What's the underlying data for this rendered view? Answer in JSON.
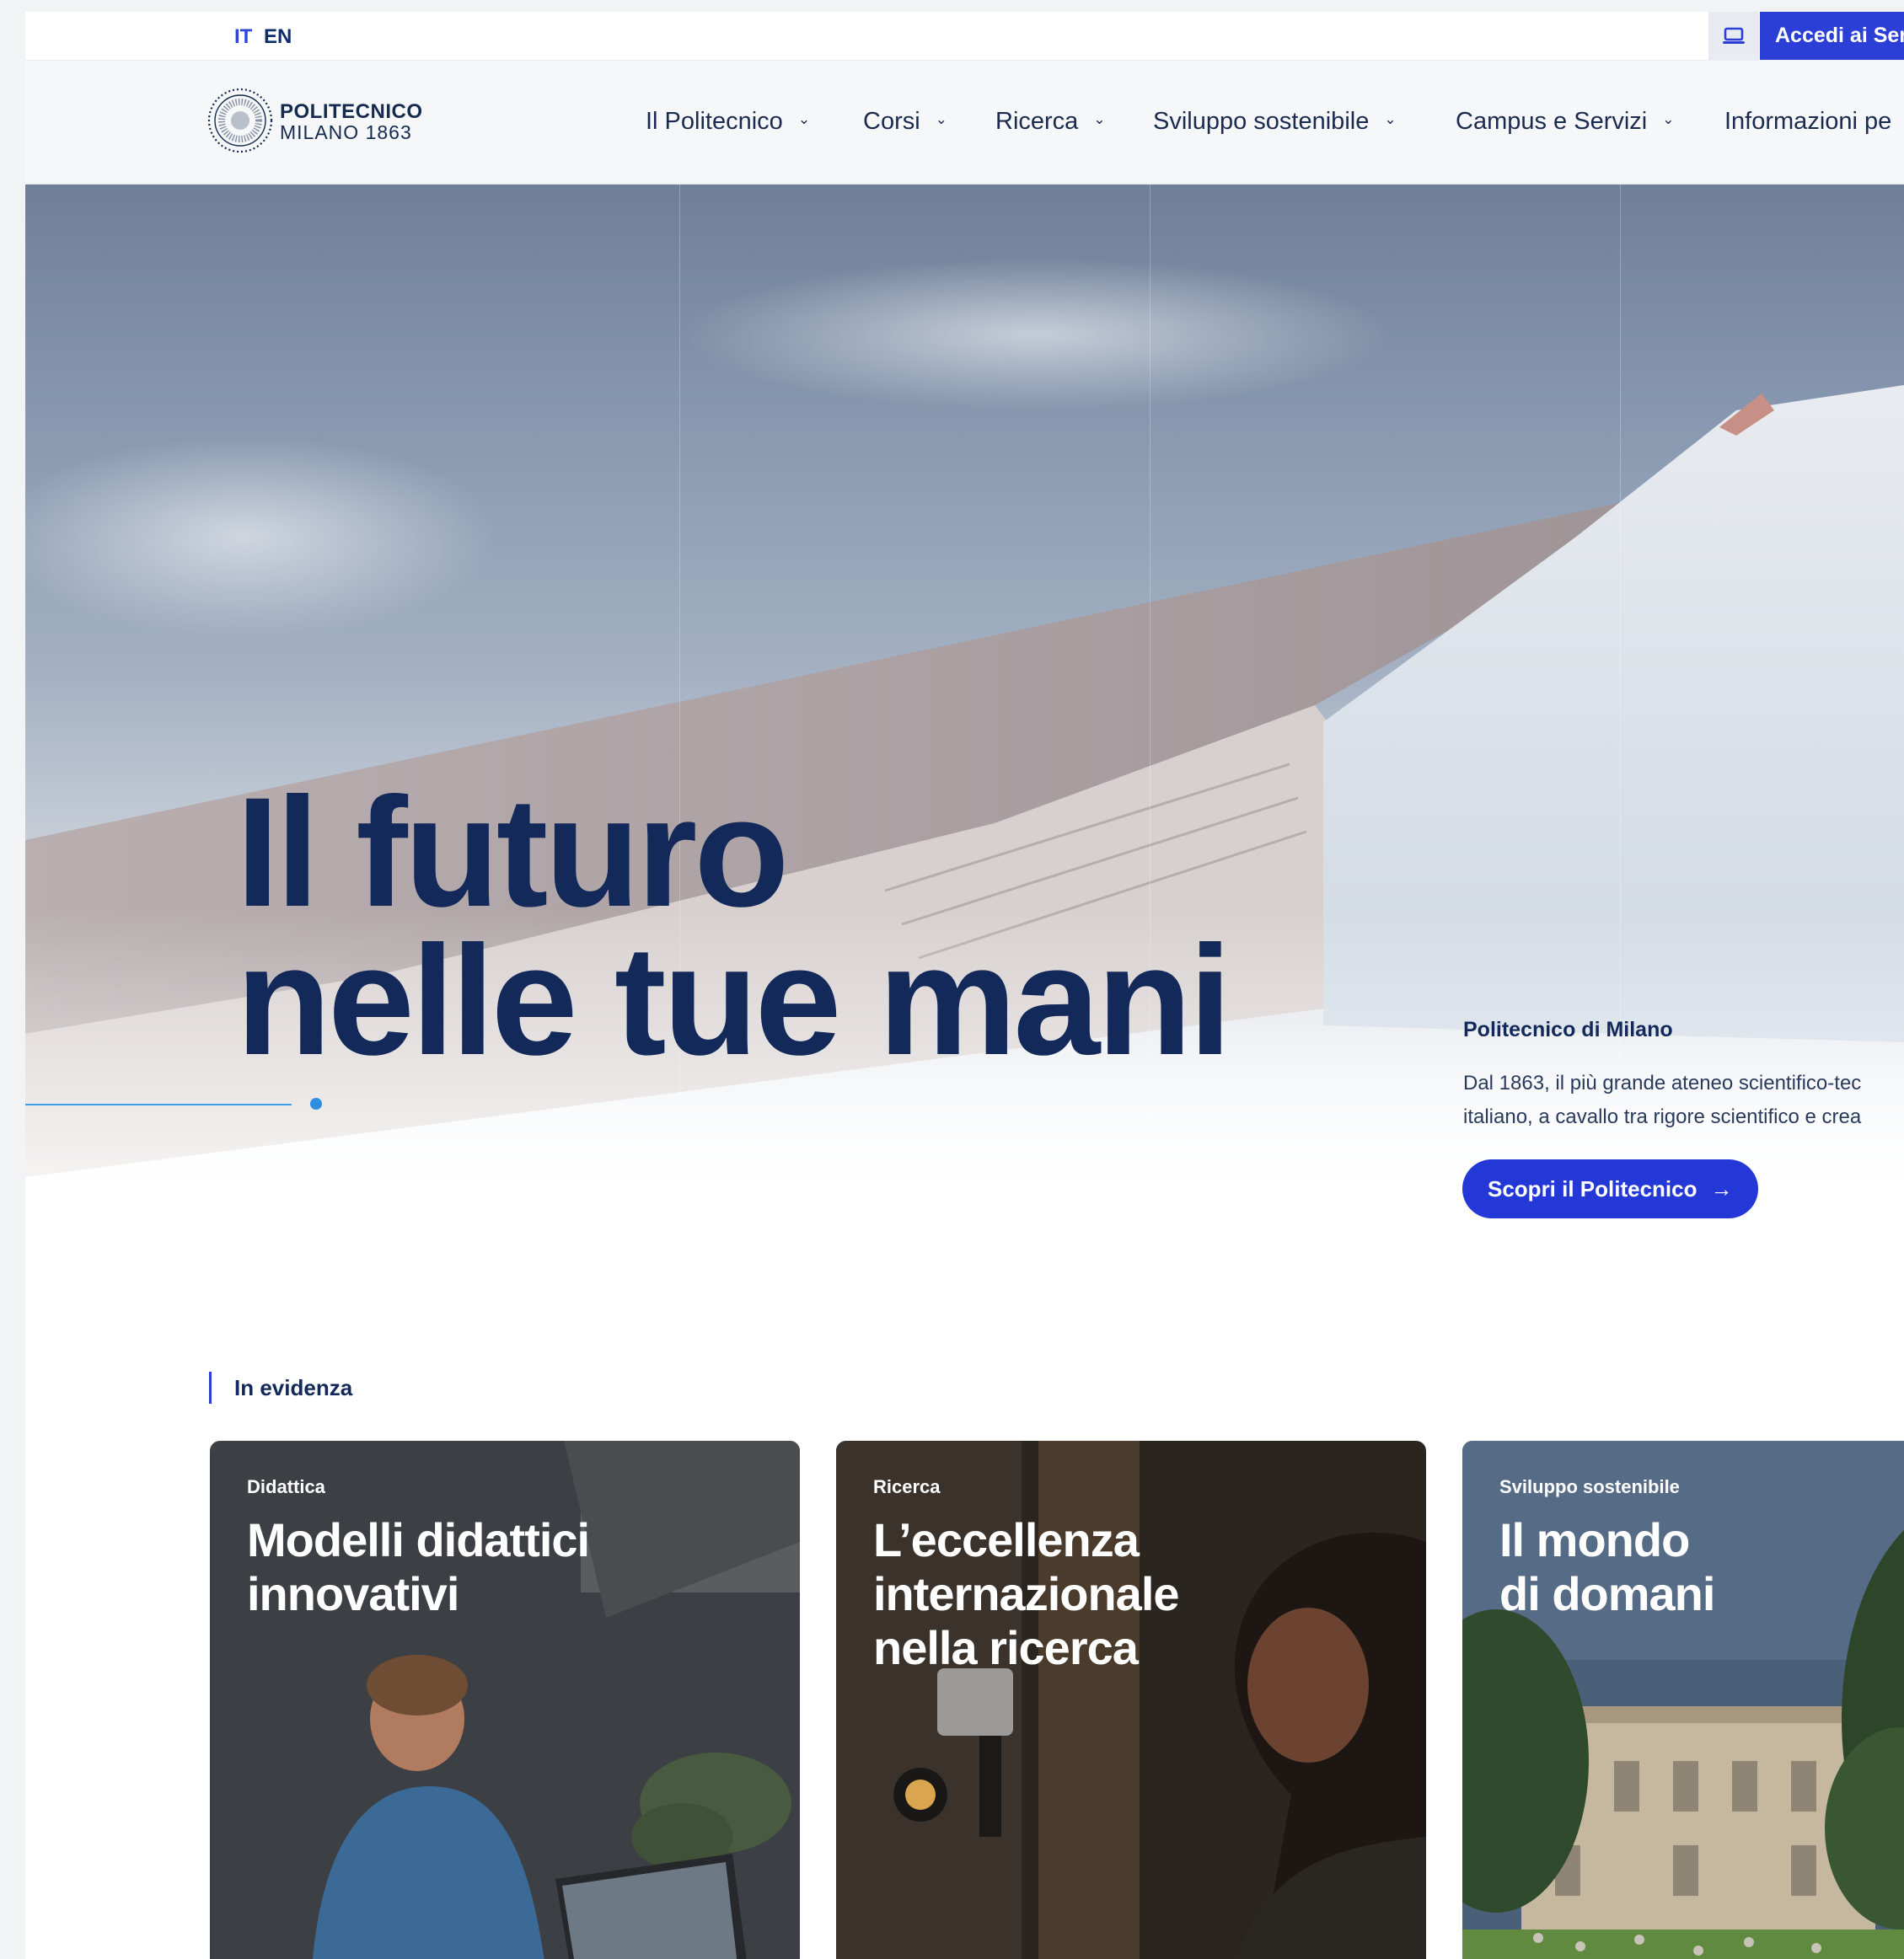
{
  "topbar": {
    "lang_it": "IT",
    "lang_en": "EN",
    "access_label": "Accedi ai Ser"
  },
  "header": {
    "logo_line1": "POLITECNICO",
    "logo_line2": "MILANO 1863",
    "nav": [
      {
        "label": "Il Politecnico"
      },
      {
        "label": "Corsi"
      },
      {
        "label": "Ricerca"
      },
      {
        "label": "Sviluppo sostenibile"
      },
      {
        "label": "Campus e Servizi"
      },
      {
        "label": "Informazioni pe"
      }
    ]
  },
  "hero": {
    "title_line1": "Il futuro",
    "title_line2": "nelle tue mani",
    "intro_title": "Politecnico di Milano",
    "intro_line1": "Dal 1863, il più grande ateneo scientifico-tec",
    "intro_line2": "italiano,  a cavallo tra rigore scientifico e crea",
    "cta_label": "Scopri il Politecnico",
    "cta_arrow": "→"
  },
  "featured": {
    "label": "In evidenza",
    "cards": [
      {
        "category": "Didattica",
        "title": "Modelli didattici\ninnovativi"
      },
      {
        "category": "Ricerca",
        "title": "L’eccellenza\ninternazionale\nnella ricerca"
      },
      {
        "category": "Sviluppo sostenibile",
        "title": "Il mondo\ndi domani"
      }
    ]
  },
  "colors": {
    "brand_blue": "#2b3fd6",
    "navy": "#13295a",
    "accent_line": "#3aa0e8"
  },
  "icons": {
    "service": "laptop-icon",
    "chevron": "chevron-down-icon",
    "arrow": "arrow-right-icon"
  }
}
